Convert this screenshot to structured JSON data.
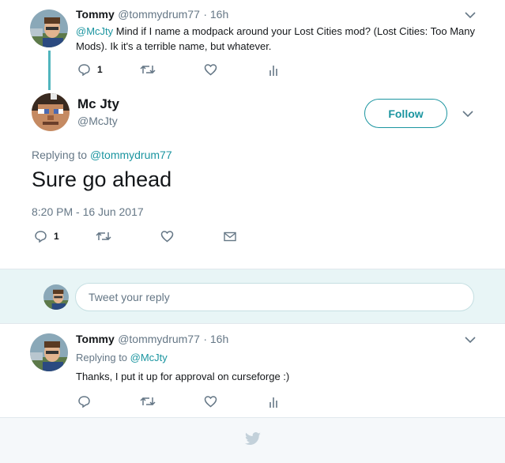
{
  "parent_tweet": {
    "name": "Tommy",
    "handle": "@tommydrum77",
    "time": "· 16h",
    "mention": "@McJty",
    "text": " Mind if I name a modpack around your Lost Cities mod? (Lost Cities: Too Many Mods). Ik it's a terrible name, but whatever.",
    "reply_count": "1"
  },
  "main_tweet": {
    "name": "Mc Jty",
    "handle": "@McJty",
    "follow_label": "Follow",
    "replying_prefix": "Replying to ",
    "replying_to": "@tommydrum77",
    "text": "Sure go ahead",
    "timestamp": "8:20 PM - 16 Jun 2017",
    "reply_count": "1"
  },
  "reply_box": {
    "placeholder": "Tweet your reply"
  },
  "child_tweet": {
    "name": "Tommy",
    "handle": "@tommydrum77",
    "time": "· 16h",
    "replying_prefix": "Replying to ",
    "replying_to": "@McJty",
    "text": "Thanks, I put it up for approval on curseforge :)"
  },
  "colors": {
    "accent": "#1b95a0",
    "reply_bar_bg": "#e8f5f6"
  },
  "icons": [
    "reply-icon",
    "retweet-icon",
    "like-icon",
    "analytics-icon",
    "dm-icon",
    "chevron-down-icon",
    "twitter-bird-icon"
  ]
}
